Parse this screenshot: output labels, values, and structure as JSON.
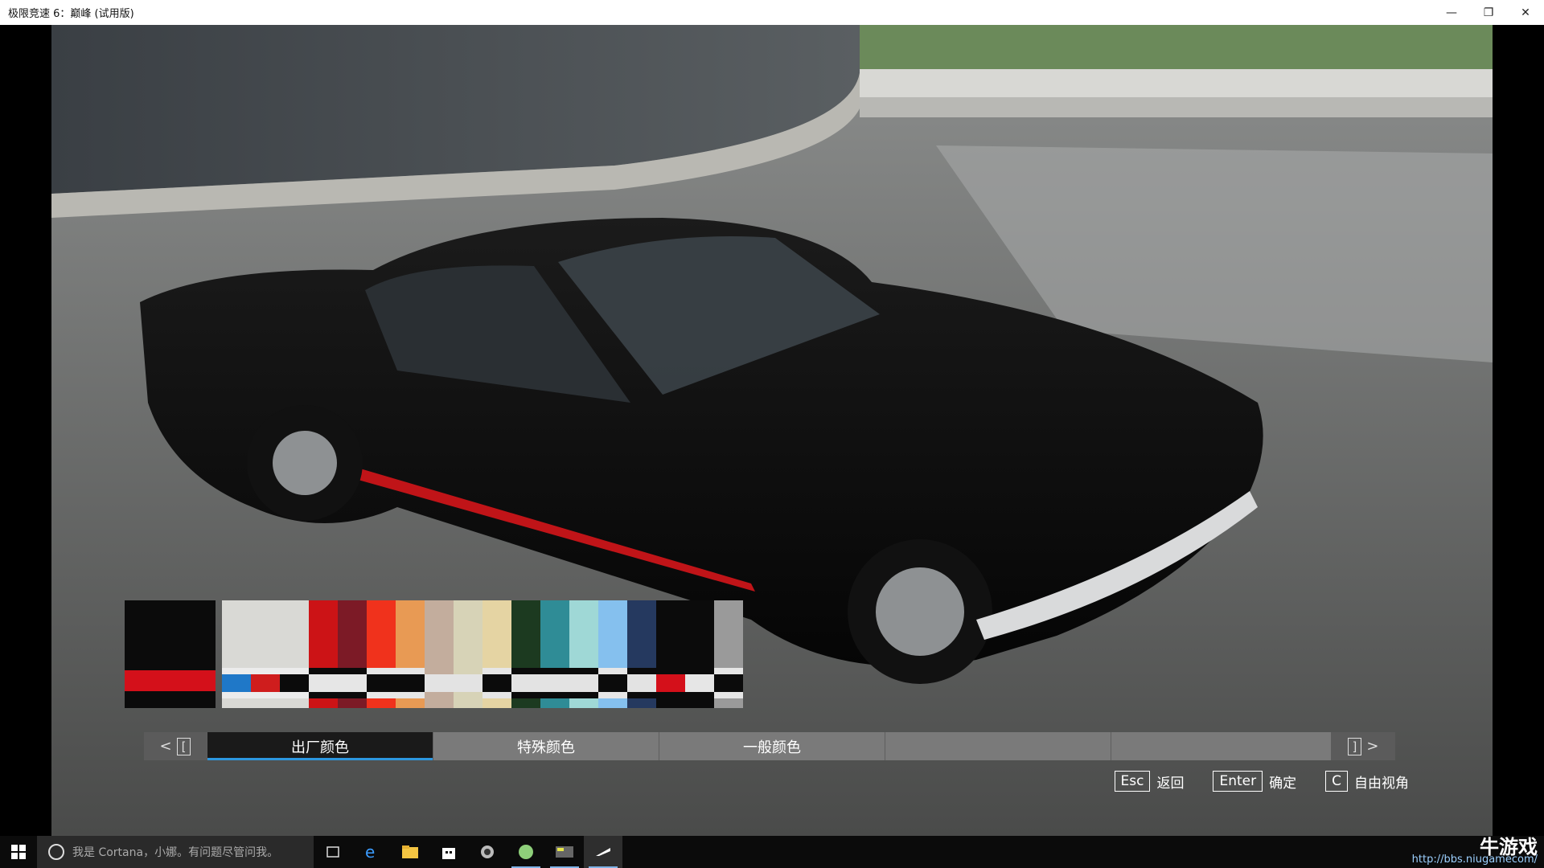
{
  "window": {
    "title": "极限竞速 6：巅峰 (试用版)",
    "minimize": "—",
    "restore": "❐",
    "close": "✕"
  },
  "palette": {
    "main": {
      "top": "#0b0b0b",
      "stripe": "#d4101a"
    },
    "swatches": [
      {
        "top": "#d9d9d5",
        "b2": "#1f78c8",
        "b1": "#ececec",
        "b3": "#ececec",
        "b4": "#d9d9d5"
      },
      {
        "top": "#d9d9d5",
        "b2": "#cf1d1d",
        "b1": "#ececec",
        "b3": "#ececec",
        "b4": "#d9d9d5"
      },
      {
        "top": "#d9d9d5",
        "b2": "#0b0b0b",
        "b1": "#ececec",
        "b3": "#ececec",
        "b4": "#d9d9d5"
      },
      {
        "top": "#cc1316",
        "b2": "#e6e6e6",
        "b1": "#0b0b0b",
        "b3": "#0b0b0b",
        "b4": "#cc1316"
      },
      {
        "top": "#7c1a26",
        "b2": "#e6e6e6",
        "b1": "#0b0b0b",
        "b3": "#0b0b0b",
        "b4": "#7c1a26"
      },
      {
        "top": "#f0321c",
        "b2": "#0b0b0b",
        "b1": "#e6e6e6",
        "b3": "#e6e6e6",
        "b4": "#f0321c"
      },
      {
        "top": "#e89a54",
        "b2": "#0b0b0b",
        "b1": "#e6e6e6",
        "b3": "#e6e6e6",
        "b4": "#e89a54"
      },
      {
        "top": "#c3ad9d",
        "b2": "#e3e3e3",
        "b1": "#c3ad9d",
        "b3": "#c3ad9d",
        "b4": "#c3ad9d"
      },
      {
        "top": "#d7d3b7",
        "b2": "#e3e3e3",
        "b1": "#d7d3b7",
        "b3": "#d7d3b7",
        "b4": "#d7d3b7"
      },
      {
        "top": "#e5d4a3",
        "b2": "#0b0b0b",
        "b1": "#e6e6e6",
        "b3": "#e6e6e6",
        "b4": "#e5d4a3"
      },
      {
        "top": "#1c3a20",
        "b2": "#e3e3e3",
        "b1": "#0b0b0b",
        "b3": "#0b0b0b",
        "b4": "#1c3a20"
      },
      {
        "top": "#2f8c96",
        "b2": "#e3e3e3",
        "b1": "#0b0b0b",
        "b3": "#0b0b0b",
        "b4": "#2f8c96"
      },
      {
        "top": "#9fd8d6",
        "b2": "#e3e3e3",
        "b1": "#0b0b0b",
        "b3": "#0b0b0b",
        "b4": "#9fd8d6"
      },
      {
        "top": "#85c0ee",
        "b2": "#0b0b0b",
        "b1": "#e6e6e6",
        "b3": "#e6e6e6",
        "b4": "#85c0ee"
      },
      {
        "top": "#25395f",
        "b2": "#e3e3e3",
        "b1": "#0b0b0b",
        "b3": "#0b0b0b",
        "b4": "#25395f"
      },
      {
        "top": "#0b0b0b",
        "b2": "#d4101a",
        "b1": "#0b0b0b",
        "b3": "#0b0b0b",
        "b4": "#0b0b0b",
        "selected": true
      },
      {
        "top": "#0b0b0b",
        "b2": "#e6e6e6",
        "b1": "#0b0b0b",
        "b3": "#0b0b0b",
        "b4": "#0b0b0b"
      },
      {
        "top": "#9a9a9a",
        "b2": "#0b0b0b",
        "b1": "#e6e6e6",
        "b3": "#e6e6e6",
        "b4": "#9a9a9a"
      }
    ]
  },
  "tabs": {
    "prev_arrow": "<",
    "prev_key": "[",
    "items": [
      "出厂颜色",
      "特殊颜色",
      "一般颜色",
      "",
      ""
    ],
    "active_index": 0,
    "next_key": "]",
    "next_arrow": ">"
  },
  "hints": [
    {
      "key": "Esc",
      "label": "返回"
    },
    {
      "key": "Enter",
      "label": "确定"
    },
    {
      "key": "C",
      "label": "自由视角"
    }
  ],
  "taskbar": {
    "search_placeholder": "我是 Cortana，小娜。有问题尽管问我。",
    "icons": [
      "task-view-icon",
      "edge-icon",
      "file-explorer-icon",
      "store-icon",
      "app-icon",
      "app-icon-2",
      "app-icon-3",
      "forza-icon"
    ]
  },
  "watermark": {
    "brand": "牛游戏",
    "url": "http://bbs.niugamecom/"
  },
  "colors": {
    "accent": "#2d97e0",
    "tab_active": "#1a1a1a",
    "tab": "#7a7a7a"
  }
}
